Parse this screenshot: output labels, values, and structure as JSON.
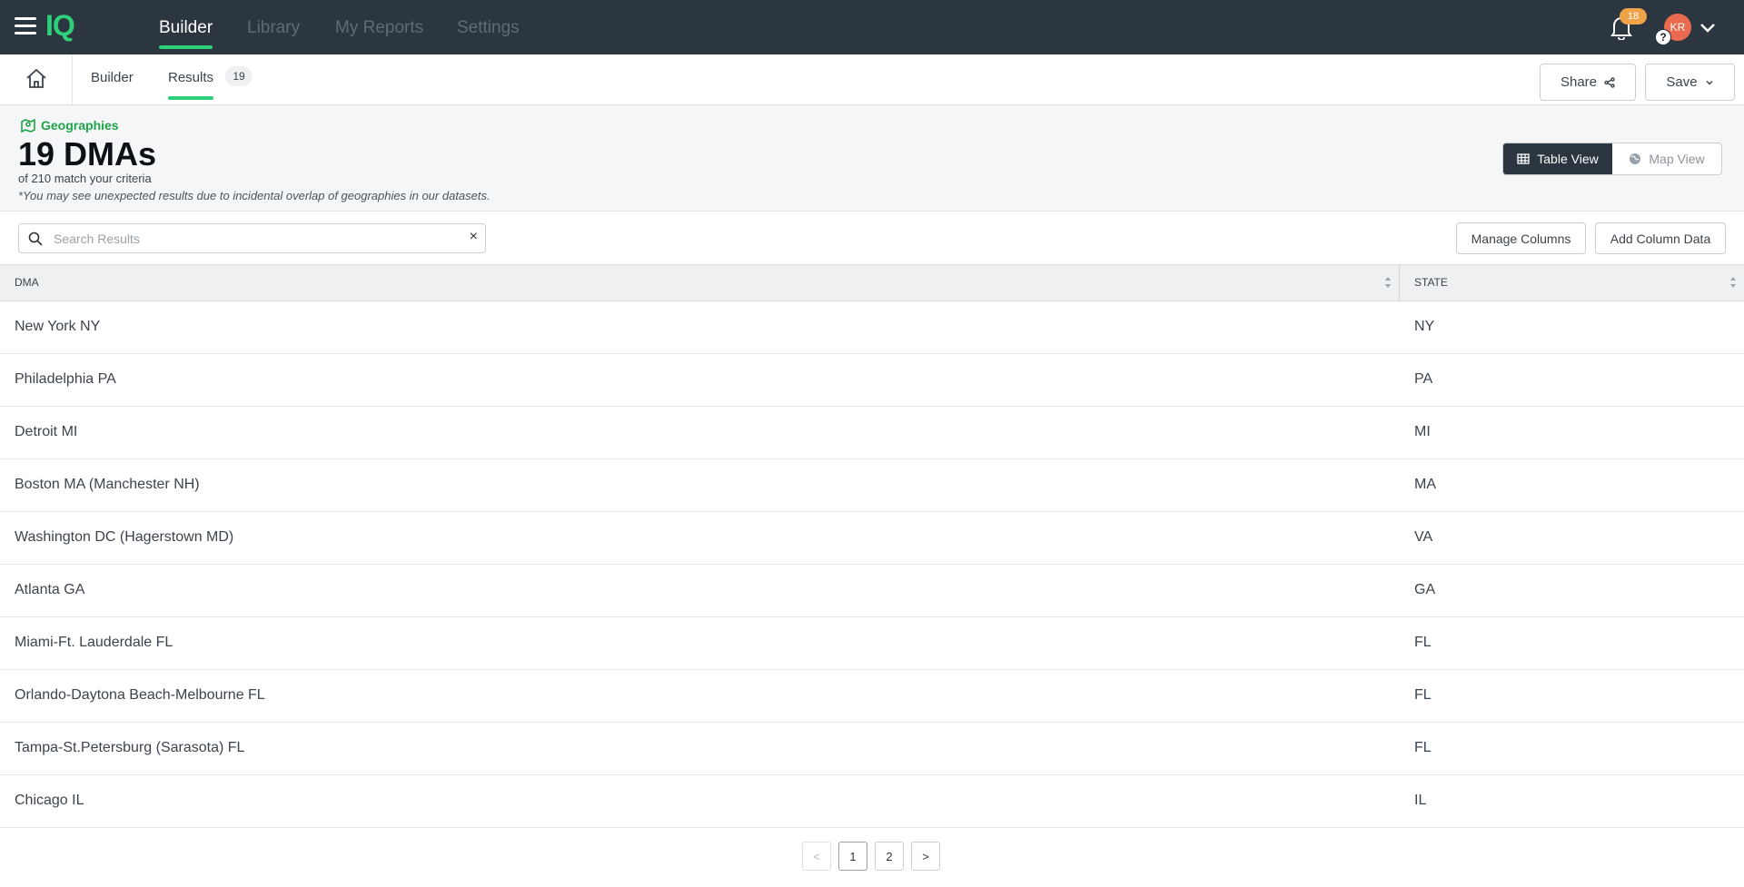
{
  "topnav": {
    "logo": "IQ",
    "links": [
      {
        "label": "Builder",
        "active": true
      },
      {
        "label": "Library",
        "active": false
      },
      {
        "label": "My Reports",
        "active": false
      },
      {
        "label": "Settings",
        "active": false
      }
    ],
    "notification_count": "18",
    "avatar_initials": "KR",
    "help_label": "?"
  },
  "subbar": {
    "tabs": [
      {
        "label": "Builder",
        "active": false
      },
      {
        "label": "Results",
        "active": true
      }
    ],
    "results_count": "19",
    "share_label": "Share",
    "save_label": "Save"
  },
  "header": {
    "category": "Geographies",
    "title": "19 DMAs",
    "subtitle": "of 210 match your criteria",
    "note": "*You may see unexpected results due to incidental overlap of geographies in our datasets.",
    "view_toggle": {
      "table": "Table View",
      "map": "Map View",
      "selected": "Table View"
    }
  },
  "toolbar": {
    "search_placeholder": "Search Results",
    "search_value": "",
    "clear_label": "×",
    "manage_columns": "Manage Columns",
    "add_column_data": "Add Column Data"
  },
  "table": {
    "columns": [
      "DMA",
      "STATE"
    ],
    "rows": [
      [
        "New York NY",
        "NY"
      ],
      [
        "Philadelphia PA",
        "PA"
      ],
      [
        "Detroit MI",
        "MI"
      ],
      [
        "Boston MA (Manchester NH)",
        "MA"
      ],
      [
        "Washington DC (Hagerstown MD)",
        "VA"
      ],
      [
        "Atlanta GA",
        "GA"
      ],
      [
        "Miami-Ft. Lauderdale FL",
        "FL"
      ],
      [
        "Orlando-Daytona Beach-Melbourne FL",
        "FL"
      ],
      [
        "Tampa-St.Petersburg (Sarasota) FL",
        "FL"
      ],
      [
        "Chicago IL",
        "IL"
      ]
    ]
  },
  "pagination": {
    "prev": "<",
    "pages": [
      "1",
      "2"
    ],
    "current": "1",
    "next": ">"
  },
  "colors": {
    "nav_bg": "#2c3640",
    "accent": "#2fd07a",
    "badge": "#f0a44a",
    "avatar": "#ea6a4f"
  }
}
